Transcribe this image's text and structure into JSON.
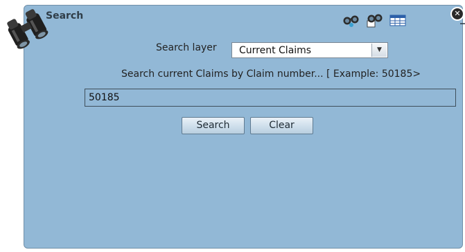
{
  "window": {
    "title": "Search",
    "icons": {
      "binoculars": "binoculars-icon",
      "tool1": "glasses-search-icon",
      "tool2": "glasses-document-icon",
      "tool3": "table-icon",
      "minimize": "minimize-icon",
      "close": "close-icon"
    },
    "minimize_glyph": "_",
    "close_glyph": "✕"
  },
  "layer": {
    "label": "Search layer",
    "selected": "Current Claims",
    "dropdown_glyph": "▼"
  },
  "hint": "Search current Claims by Claim number... [ Example: 50185>",
  "search_input": {
    "value": "50185"
  },
  "buttons": {
    "search": "Search",
    "clear": "Clear"
  },
  "colors": {
    "panel": "#92b8d6",
    "border": "#6f8fa8"
  }
}
